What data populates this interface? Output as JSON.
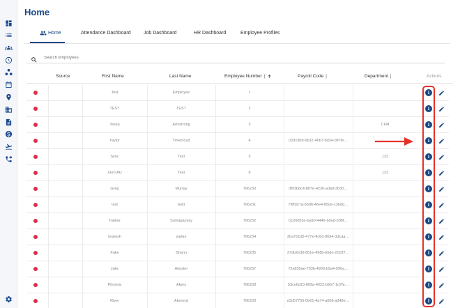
{
  "page_title": "Home",
  "tabs": [
    {
      "label": "Home",
      "active": true
    },
    {
      "label": "Attendance Dashboard"
    },
    {
      "label": "Job Dashboard"
    },
    {
      "label": "HR Dashboard"
    },
    {
      "label": "Employee Profiles"
    }
  ],
  "search": {
    "placeholder": "Search employees"
  },
  "table": {
    "headers": {
      "source": "Source",
      "first_name": "First Name",
      "last_name": "Last Name",
      "employee_number": "Employee Number",
      "payroll_code": "Payroll Code",
      "department": "Department",
      "actions": "Actions"
    },
    "rows": [
      {
        "first_name": "Test",
        "last_name": "Employee",
        "employee_number": "1",
        "payroll_code": "",
        "department": ""
      },
      {
        "first_name": "TEST",
        "last_name": "TEST",
        "employee_number": "2",
        "payroll_code": "",
        "department": ""
      },
      {
        "first_name": "Tessa",
        "last_name": "Armstrong",
        "employee_number": "3",
        "payroll_code": "",
        "department": "CFM"
      },
      {
        "first_name": "Taylor",
        "last_name": "Timecloud",
        "employee_number": "4",
        "payroll_code": "02d19b9-9b32-46b7-bd34-087fe…",
        "department": ""
      },
      {
        "first_name": "Sync",
        "last_name": "Test",
        "employee_number": "5",
        "payroll_code": "",
        "department": "123"
      },
      {
        "first_name": "Xero AU",
        "last_name": "Test",
        "employee_number": "6",
        "payroll_code": "",
        "department": "123"
      },
      {
        "first_name": "Greg",
        "last_name": "Murray",
        "employee_number": "766230",
        "payroll_code": "df93b8c4-887e-4230-ada9-3830…",
        "department": ""
      },
      {
        "first_name": "test",
        "last_name": "testt",
        "employee_number": "766231",
        "payroll_code": "7f8f927a-66d6-46e4-85de-c36dd…",
        "department": ""
      },
      {
        "first_name": "Topher",
        "last_name": "Sumagaysay",
        "employee_number": "766232",
        "payroll_code": "b126053e-ba90-4449-b9ad-b08f…",
        "department": ""
      },
      {
        "first_name": "mukesh",
        "last_name": "yadav",
        "employee_number": "766234",
        "payroll_code": "2ba751d5-477e-4c6d-9694-3d1aa…",
        "department": ""
      },
      {
        "first_name": "Fake",
        "last_name": "Shann",
        "employee_number": "766235",
        "payroll_code": "37db2e30-801e-498b-b6de-21037…",
        "department": ""
      },
      {
        "first_name": "Jake",
        "last_name": "Akester",
        "employee_number": "766237",
        "payroll_code": "72a830ae-763b-4906-b9a4-596a…",
        "department": ""
      },
      {
        "first_name": "Phoenix",
        "last_name": "Akers",
        "employee_number": "766238",
        "payroll_code": "53ce6d13-869a-4922-b9b7-1d7fe…",
        "department": ""
      },
      {
        "first_name": "River",
        "last_name": "Akeroyd",
        "employee_number": "766239",
        "payroll_code": "d3d57756-0b61-4a74-a668-a349e…",
        "department": ""
      }
    ]
  },
  "icons": {
    "info": "i",
    "sidebar": [
      "dashboard-icon",
      "list-icon",
      "people-icon",
      "clock-icon",
      "org-chart-icon",
      "calendar-icon",
      "location-icon",
      "building-icon",
      "document-icon",
      "dollar-icon",
      "flight-icon",
      "phone-forward-icon",
      "settings-icon"
    ]
  },
  "colors": {
    "accent": "#1a4784",
    "status_dot": "#d9304c",
    "annotation": "#e4322b"
  }
}
